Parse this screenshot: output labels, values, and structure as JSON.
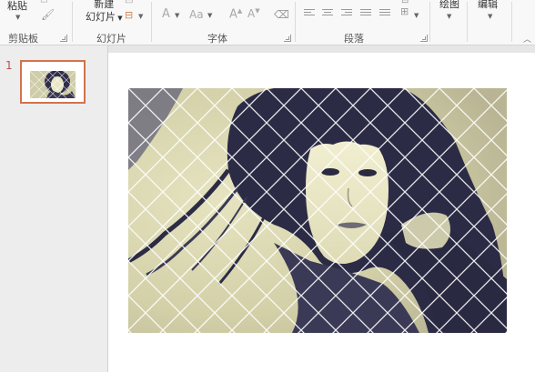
{
  "ribbon": {
    "clipboard": {
      "paste_label": "粘贴",
      "group_label": "剪贴板"
    },
    "slides": {
      "new_slide_line1": "新建",
      "new_slide_line2": "幻灯片",
      "group_label": "幻灯片"
    },
    "font": {
      "font_color_glyph": "A",
      "change_case_glyph": "Aa",
      "grow_font_glyph": "A",
      "group_label": "字体"
    },
    "paragraph": {
      "group_label": "段落"
    },
    "drawing": {
      "label": "绘图"
    },
    "editing": {
      "label": "编辑"
    }
  },
  "thumbnails": {
    "slide_number": "1"
  },
  "colors": {
    "thumbnail_selection_border": "#d0734d",
    "slide_number": "#c0504d",
    "photo_sepia": "#dcdab2",
    "hair_dark": "#2c2b45"
  },
  "icons": [
    "format-painter-icon",
    "paragraph-align-icon",
    "clear-format-icon",
    "dialog-launcher-icon",
    "scroll-up-icon"
  ]
}
